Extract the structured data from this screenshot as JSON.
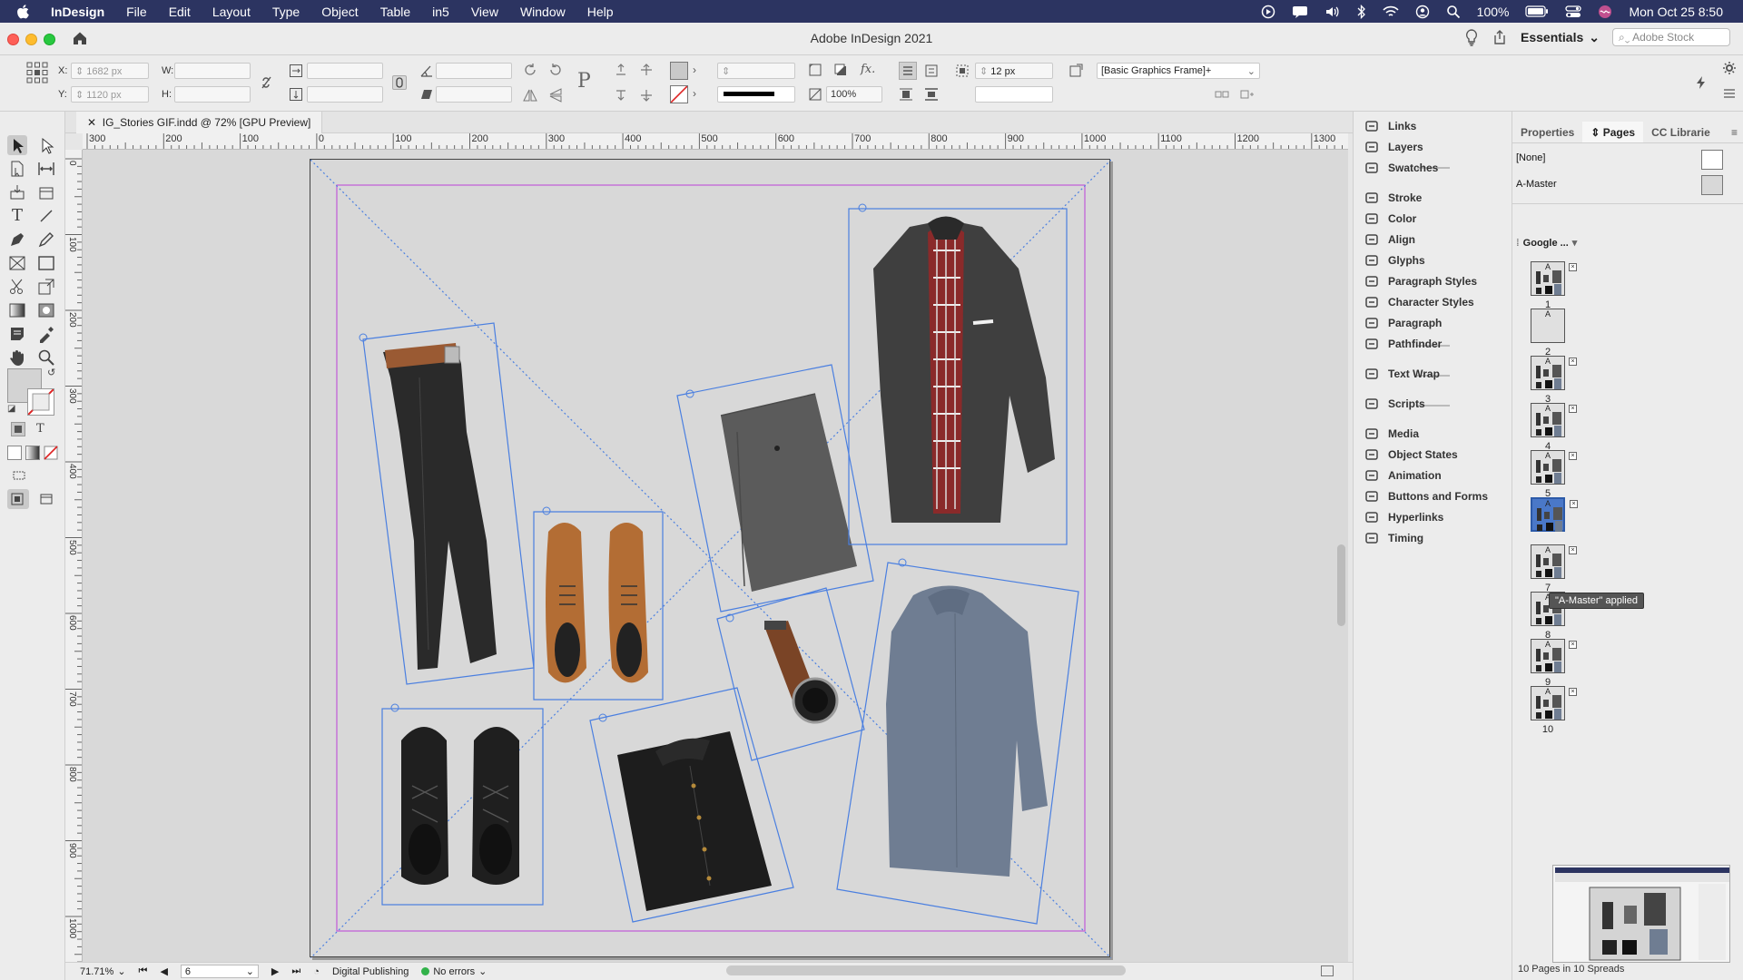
{
  "menubar": {
    "app": "InDesign",
    "items": [
      "File",
      "Edit",
      "Layout",
      "Type",
      "Object",
      "Table",
      "in5",
      "View",
      "Window",
      "Help"
    ],
    "battery": "100%",
    "clock": "Mon Oct 25  8:50"
  },
  "window": {
    "title": "Adobe InDesign 2021",
    "workspace": "Essentials",
    "stock_placeholder": "Adobe Stock"
  },
  "control": {
    "x_label": "X:",
    "x_value": "1682 px",
    "y_label": "Y:",
    "y_value": "1120 px",
    "w_label": "W:",
    "h_label": "H:",
    "stroke_weight": "12 px",
    "opacity": "100%",
    "object_style": "[Basic Graphics Frame]+"
  },
  "document": {
    "tab_title": "IG_Stories GIF.indd @ 72% [GPU Preview]"
  },
  "ruler": {
    "h_labels": [
      "300",
      "200",
      "100",
      "0",
      "100",
      "200",
      "300",
      "400",
      "500",
      "600",
      "700",
      "800",
      "900",
      "1000",
      "1100",
      "1200",
      "1300"
    ],
    "v_labels": [
      "0",
      "100",
      "200",
      "300",
      "400",
      "500",
      "600",
      "700",
      "800",
      "900",
      "1000"
    ]
  },
  "status": {
    "zoom": "71.71%",
    "page": "6",
    "preflight_profile": "Digital Publishing",
    "errors": "No errors"
  },
  "panels": {
    "items": [
      {
        "label": "Links",
        "icon": "links-icon"
      },
      {
        "label": "Layers",
        "icon": "layers-icon"
      },
      {
        "label": "Swatches",
        "icon": "swatches-icon"
      },
      {
        "label": "Stroke",
        "icon": "stroke-icon"
      },
      {
        "label": "Color",
        "icon": "color-icon"
      },
      {
        "label": "Align",
        "icon": "align-icon"
      },
      {
        "label": "Glyphs",
        "icon": "glyphs-icon"
      },
      {
        "label": "Paragraph Styles",
        "icon": "paragraph-styles-icon"
      },
      {
        "label": "Character Styles",
        "icon": "character-styles-icon"
      },
      {
        "label": "Paragraph",
        "icon": "paragraph-icon"
      },
      {
        "label": "Pathfinder",
        "icon": "pathfinder-icon"
      },
      {
        "label": "Text Wrap",
        "icon": "text-wrap-icon"
      },
      {
        "label": "Scripts",
        "icon": "scripts-icon"
      },
      {
        "label": "Media",
        "icon": "media-icon"
      },
      {
        "label": "Object States",
        "icon": "object-states-icon"
      },
      {
        "label": "Animation",
        "icon": "animation-icon"
      },
      {
        "label": "Buttons and Forms",
        "icon": "buttons-forms-icon"
      },
      {
        "label": "Hyperlinks",
        "icon": "hyperlinks-icon"
      },
      {
        "label": "Timing",
        "icon": "timing-icon"
      }
    ]
  },
  "pages_panel": {
    "tabs": [
      "Properties",
      "Pages",
      "CC Librarie"
    ],
    "active_tab": "Pages",
    "masters": [
      "[None]",
      "A-Master"
    ],
    "size_menu": "Google ...",
    "pages": [
      "1",
      "2",
      "3",
      "4",
      "5",
      "6",
      "7",
      "8",
      "9",
      "10"
    ],
    "tooltip": "\"A-Master\" applied",
    "summary": "10 Pages in 10 Spreads"
  }
}
